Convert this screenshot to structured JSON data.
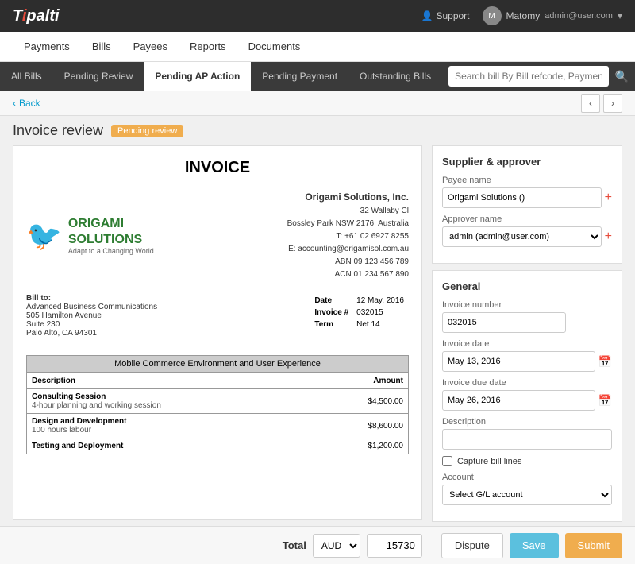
{
  "app": {
    "logo": "Tipalti",
    "logo_accent": "i"
  },
  "header": {
    "support_label": "Support",
    "user_name": "Matomy",
    "user_email": "admin@user.com"
  },
  "nav": {
    "items": [
      "Payments",
      "Bills",
      "Payees",
      "Reports",
      "Documents"
    ]
  },
  "tabs": {
    "items": [
      "All Bills",
      "Pending Review",
      "Pending AP Action",
      "Pending Payment",
      "Outstanding Bills"
    ],
    "active": "Pending AP Action",
    "search_placeholder": "Search bill By Bill refcode, Payment refcode, Payee ID, Name, Company or Alias"
  },
  "breadcrumb": {
    "back_label": "Back"
  },
  "page": {
    "title": "Invoice review",
    "status": "Pending review"
  },
  "invoice": {
    "title": "INVOICE",
    "company_name": "Origami Solutions, Inc.",
    "company_address": "32 Wallaby Cl",
    "company_city": "Bossley Park NSW 2176, Australia",
    "company_phone": "T: +61 02 6927 8255",
    "company_email": "E: accounting@origamisol.com.au",
    "company_abn": "ABN 09 123 456 789",
    "company_acn": "ACN 01 234 567 890",
    "bill_to": "Bill to:",
    "bill_company": "Advanced Business Communications",
    "bill_address1": "505 Hamilton Avenue",
    "bill_address2": "Suite 230",
    "bill_city": "Palo Alto, CA 94301",
    "date_label": "Date",
    "date_value": "12 May, 2016",
    "invoice_no_label": "Invoice #",
    "invoice_no_value": "032015",
    "term_label": "Term",
    "term_value": "Net 14",
    "project_header": "Mobile Commerce Environment and User Experience",
    "table_headers": [
      "Description",
      "Amount"
    ],
    "line_items": [
      {
        "name": "Consulting Session",
        "desc": "4-hour planning and working session",
        "amount": "$4,500.00"
      },
      {
        "name": "Design and Development",
        "desc": "100 hours labour",
        "amount": "$8,600.00"
      },
      {
        "name": "Testing and Deployment",
        "desc": "",
        "amount": "$1,200.00"
      }
    ]
  },
  "supplier": {
    "section_title": "Supplier & approver",
    "payee_label": "Payee name",
    "payee_value": "Origami Solutions ()",
    "approver_label": "Approver name",
    "approver_value": "admin (admin@user.com)"
  },
  "general": {
    "section_title": "General",
    "invoice_number_label": "Invoice number",
    "invoice_number_value": "032015",
    "invoice_date_label": "Invoice date",
    "invoice_date_value": "May 13, 2016",
    "invoice_due_label": "Invoice due date",
    "invoice_due_value": "May 26, 2016",
    "description_label": "Description",
    "capture_label": "Capture bill lines",
    "account_label": "Account",
    "account_placeholder": "Select G/L account"
  },
  "bottom": {
    "total_label": "Total",
    "currency": "AUD",
    "total_amount": "15730",
    "dispute_label": "Dispute",
    "save_label": "Save",
    "submit_label": "Submit"
  }
}
